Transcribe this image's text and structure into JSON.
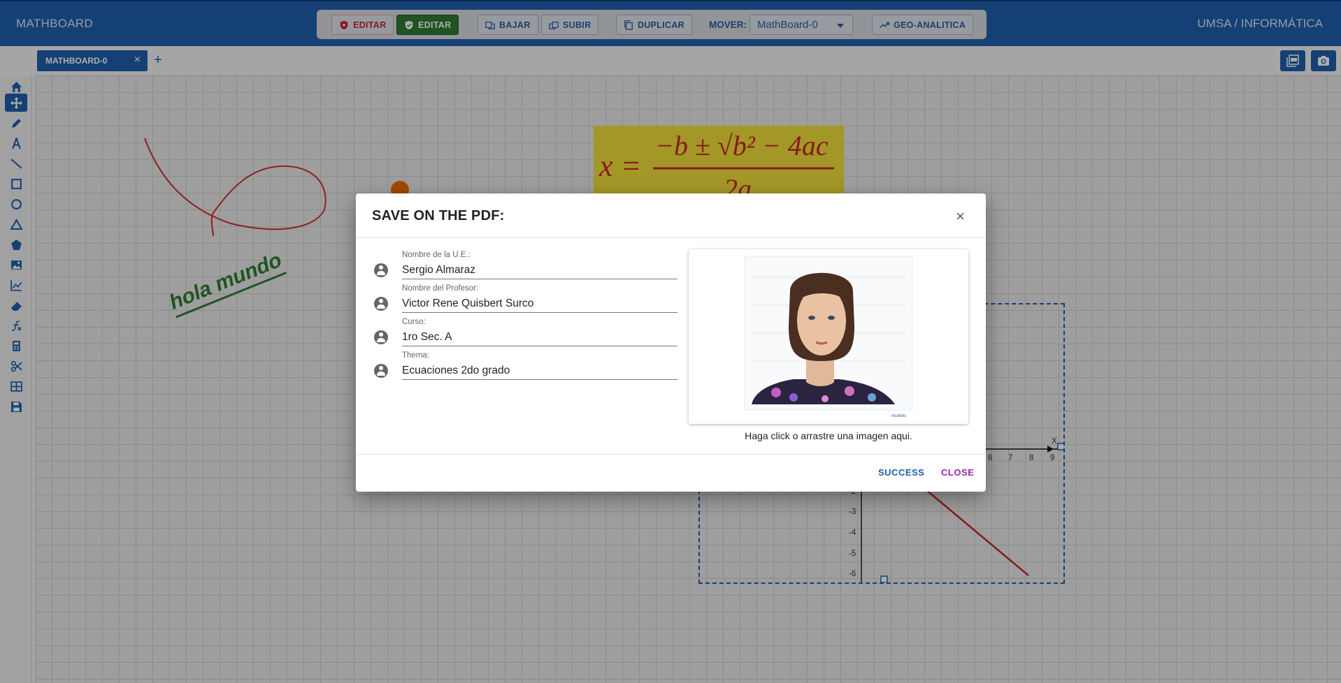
{
  "app": {
    "brand": "MATHBOARD",
    "org": "UMSA / INFORMÁTICA"
  },
  "toolbar": {
    "editar_red": "EDITAR",
    "editar_green": "EDITAR",
    "bajar": "BAJAR",
    "subir": "SUBIR",
    "duplicar": "DUPLICAR",
    "mover_label": "MOVER:",
    "mover_value": "MathBoard-0",
    "geo": "GEO-ANALITICA"
  },
  "tabs": [
    {
      "label": "MATHBOARD-0"
    }
  ],
  "tabs_add": "+",
  "canvas": {
    "hola_text": "hola mundo",
    "plot_x_ticks": [
      "6",
      "7",
      "8",
      "9"
    ],
    "plot_y_ticks": [
      "-2",
      "-3",
      "-4",
      "-5",
      "-6"
    ],
    "plot_axis_label": "X"
  },
  "modal": {
    "title": "SAVE ON THE PDF:",
    "close_glyph": "×",
    "fields": [
      {
        "label": "Nombre de la U.E.:",
        "value": "Sergio Almaraz"
      },
      {
        "label": "Nombre del Profesor:",
        "value": "Victor Rene Quisbert Surco"
      },
      {
        "label": "Curso:",
        "value": "1ro Sec. A"
      },
      {
        "label": "Thema:",
        "value": "Ecuaciones 2do grado"
      }
    ],
    "image_caption": "Haga click o arrastre una imagen aqui.",
    "success_label": "SUCCESS",
    "close_label": "CLOSE"
  },
  "colors": {
    "primary": "#1f5fad",
    "success_green": "#2e7d32",
    "danger_red": "#c62828",
    "close_purple": "#9c27b0"
  }
}
